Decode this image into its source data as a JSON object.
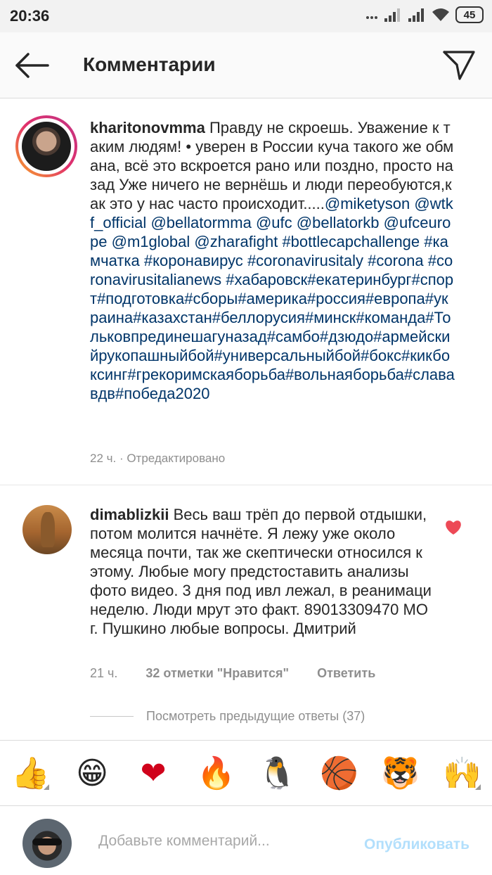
{
  "status_bar": {
    "time": "20:36",
    "battery": "45"
  },
  "header": {
    "title": "Комментарии"
  },
  "caption": {
    "username": "kharitonovmma",
    "segments": [
      {
        "t": " Правду не скроешь. Уважение к таким людям! • уверен в России куча такого же обмана, всё это вскроется рано или поздно, просто назад Уже ничего не вернёшь и люди переобуются,как это у нас часто происходит.....",
        "tag": false
      },
      {
        "t": "@miketyson",
        "tag": true
      },
      {
        "t": " ",
        "tag": false
      },
      {
        "t": "@wtkf_official",
        "tag": true
      },
      {
        "t": " ",
        "tag": false
      },
      {
        "t": "@bellatormma",
        "tag": true
      },
      {
        "t": " ",
        "tag": false
      },
      {
        "t": "@ufc",
        "tag": true
      },
      {
        "t": " ",
        "tag": false
      },
      {
        "t": "@bellatorkb",
        "tag": true
      },
      {
        "t": " ",
        "tag": false
      },
      {
        "t": "@ufceurope",
        "tag": true
      },
      {
        "t": " ",
        "tag": false
      },
      {
        "t": "@m1global",
        "tag": true
      },
      {
        "t": " ",
        "tag": false
      },
      {
        "t": "@zharafight",
        "tag": true
      },
      {
        "t": "  ",
        "tag": false
      },
      {
        "t": "#bottlecapchallenge",
        "tag": true
      },
      {
        "t": " ",
        "tag": false
      },
      {
        "t": "#камчатка",
        "tag": true
      },
      {
        "t": " ",
        "tag": false
      },
      {
        "t": "#коронавирус",
        "tag": true
      },
      {
        "t": " ",
        "tag": false
      },
      {
        "t": "#coronavirusitaly",
        "tag": true
      },
      {
        "t": " ",
        "tag": false
      },
      {
        "t": "#corona",
        "tag": true
      },
      {
        "t": " ",
        "tag": false
      },
      {
        "t": "#coronavirusitalianews",
        "tag": true
      },
      {
        "t": " ",
        "tag": false
      },
      {
        "t": "#хабаровск#екатеринбург#спорт#подготовка#сборы#америка#россия#европа#украина#казахстан#беллорусия#минск#команда#Тольковпрединешагуназад#самбо#дзюдо#армейскийрукопашныйбой#универсальныйбой#бокс#кикбоксинг#грекоримскаяборьба#вольнаяборьба#слававдв#победа2020",
        "tag": true
      }
    ],
    "time": "22 ч.",
    "separator": " · ",
    "edited": "Отредактировано"
  },
  "comment": {
    "username": "dimablizkii",
    "text": "Весь ваш трёп до первой отдышки, потом молится начнёте. Я лежу уже около месяца почти, так же скептически относился к этому.  Любые могу предстоставить анализы фото видео. 3 дня под ивл лежал, в реанимаци неделю. Люди мрут это факт. 89013309470 МО г. Пушкино любые вопросы. Дмитрий",
    "time": "21 ч.",
    "likes": "32 отметки \"Нравится\"",
    "reply": "Ответить",
    "view_replies": "Посмотреть предыдущие ответы (37)"
  },
  "emoji_bar": {
    "items": [
      {
        "name": "thumbs-up-emoji",
        "glyph": "👍"
      },
      {
        "name": "grinning-emoji",
        "glyph": "😁"
      },
      {
        "name": "red-heart-emoji",
        "glyph": "❤"
      },
      {
        "name": "fire-emoji",
        "glyph": "🔥"
      },
      {
        "name": "penguin-emoji",
        "glyph": "🐧"
      },
      {
        "name": "basketball-emoji",
        "glyph": "🏀"
      },
      {
        "name": "tiger-emoji",
        "glyph": "🐯"
      },
      {
        "name": "raised-hands-emoji",
        "glyph": "🙌"
      }
    ]
  },
  "composer": {
    "placeholder": "Добавьте комментарий...",
    "publish_label": "Опубликовать"
  },
  "colors": {
    "accent_link": "#003569",
    "heart": "#ed4956",
    "publish_disabled": "#b2dffc"
  }
}
